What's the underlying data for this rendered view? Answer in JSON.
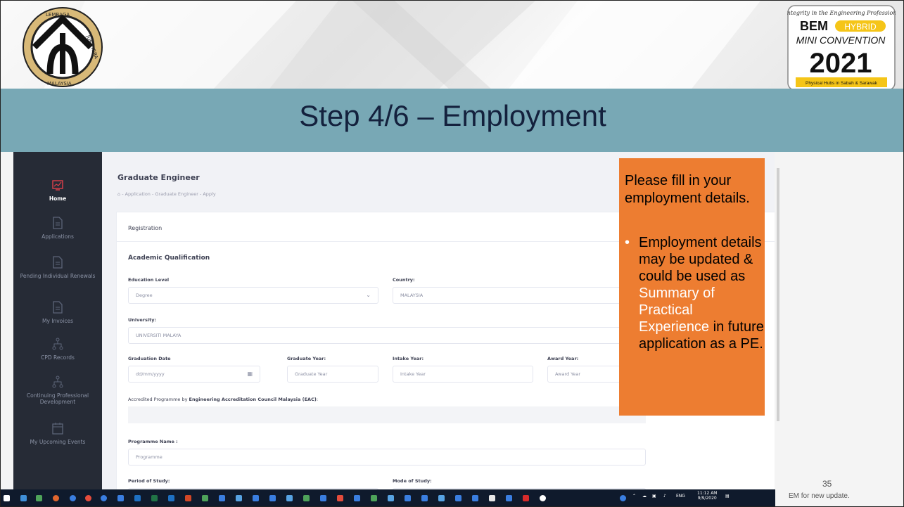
{
  "slide": {
    "title": "Step 4/6 – Employment",
    "slide_number": "35",
    "footer_note": "EM for new update."
  },
  "logos": {
    "left": "bem-seal-logo",
    "right": {
      "tagline": "Integrity in the Engineering Profession",
      "line1": "BEM",
      "line1_badge": "HYBRID",
      "line2": "MINI CONVENTION",
      "year": "2021",
      "bottom": "Physical Hubs in Sabah & Sarawak"
    },
    "left_text": {
      "top": "LEMBAGA",
      "right": "JURUTERA",
      "bottom": "MALAYSIA"
    }
  },
  "sidebar": {
    "items": [
      {
        "label": "Home",
        "icon": "chart-icon",
        "active": true
      },
      {
        "label": "Applications",
        "icon": "document-icon",
        "active": false
      },
      {
        "label": "Pending Individual Renewals",
        "icon": "document-icon",
        "active": false
      },
      {
        "label": "My Invoices",
        "icon": "document-icon",
        "active": false
      },
      {
        "label": "CPD Records",
        "icon": "sitemap-icon",
        "active": false
      },
      {
        "label": "Continuing Professional Development",
        "icon": "sitemap-icon",
        "active": false
      },
      {
        "label": "My Upcoming Events",
        "icon": "calendar-icon",
        "active": false
      }
    ]
  },
  "page": {
    "title": "Graduate Engineer",
    "breadcrumb": "⌂   -  Application  -  Graduate Engineer  -  Apply",
    "card_header": "Registration",
    "section": "Academic Qualification",
    "fields": {
      "education_level": {
        "label": "Education Level",
        "value": "Degree"
      },
      "country": {
        "label": "Country:",
        "value": "MALAYSIA"
      },
      "university": {
        "label": "University:",
        "value": "UNIVERSITI MALAYA"
      },
      "graduation_date": {
        "label": "Graduation Date",
        "placeholder": "dd/mm/yyyy"
      },
      "graduate_year": {
        "label": "Graduate Year:",
        "placeholder": "Graduate Year"
      },
      "intake_year": {
        "label": "Intake Year:",
        "placeholder": "Intake Year"
      },
      "award_year": {
        "label": "Award Year:",
        "placeholder": "Award Year"
      },
      "accredited": {
        "label": "Accredited Programme by ",
        "label_bold": "Engineering Accreditation Council Malaysia (EAC)",
        "label_end": ":"
      },
      "programme_name": {
        "label": "Programme Name :",
        "placeholder": "Programme"
      },
      "period_of_study": {
        "label": "Period of Study:"
      },
      "mode_of_study": {
        "label": "Mode of Study:"
      }
    }
  },
  "callout": {
    "main": "Please fill in your employment details.",
    "bullet_before": "Employment details may be updated & could be used as ",
    "bullet_highlight": "Summary of Practical Experience",
    "bullet_after": " in future application as a PE.",
    "bullet_glyph": "•",
    "bg_color": "#ed7d31"
  },
  "taskbar": {
    "language": "ENG",
    "time": "11:12 AM",
    "date": "9/9/2020"
  }
}
